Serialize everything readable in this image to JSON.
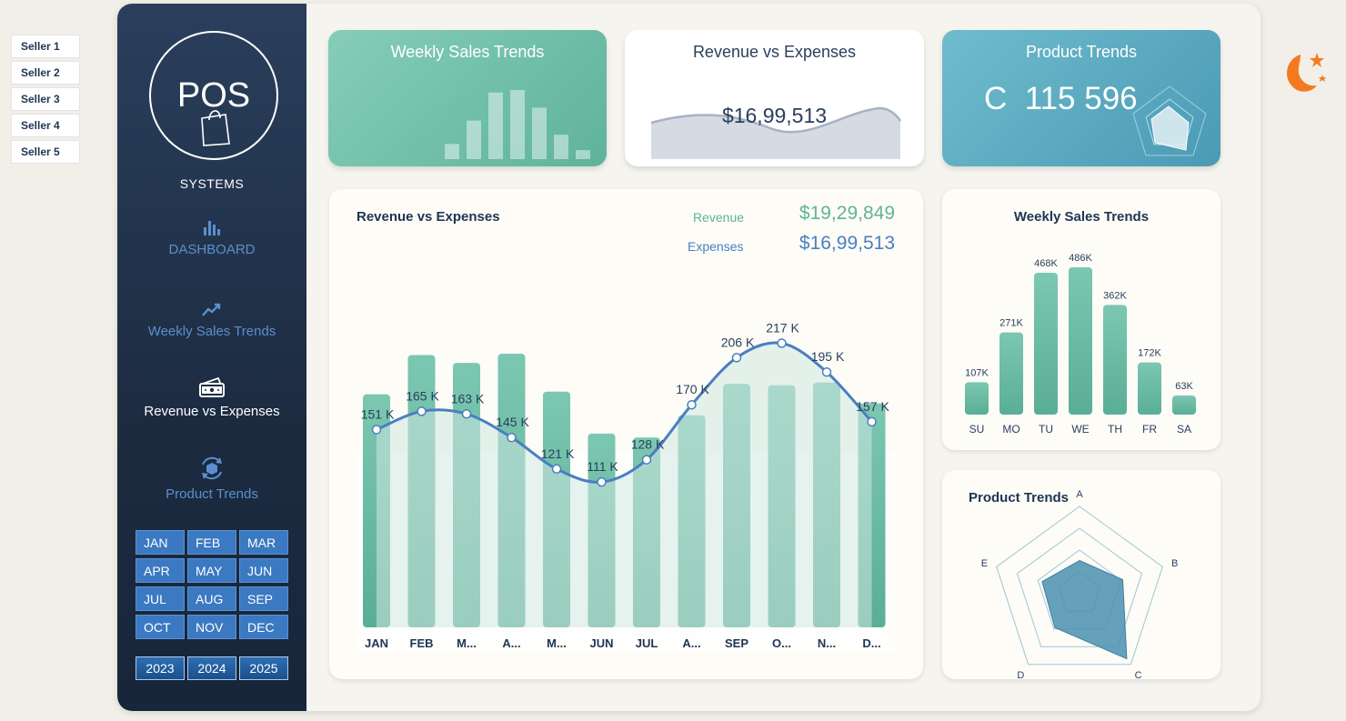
{
  "sellers": [
    "Seller 1",
    "Seller 2",
    "Seller 3",
    "Seller 4",
    "Seller 5"
  ],
  "sidebar": {
    "logo_title": "POS",
    "logo_subtitle": "SYSTEMS",
    "nav": [
      {
        "label": "DASHBOARD",
        "icon": "bar-chart-icon",
        "active": false
      },
      {
        "label": "Weekly Sales Trends",
        "icon": "trend-up-icon",
        "active": false
      },
      {
        "label": "Revenue vs Expenses",
        "icon": "wallet-icon",
        "active": true
      },
      {
        "label": "Product Trends",
        "icon": "cube-cycle-icon",
        "active": false
      }
    ],
    "months": [
      "JAN",
      "FEB",
      "MAR",
      "APR",
      "MAY",
      "JUN",
      "JUL",
      "AUG",
      "SEP",
      "OCT",
      "NOV",
      "DEC"
    ],
    "years": [
      "2023",
      "2024",
      "2025"
    ]
  },
  "kpi": {
    "weekly": {
      "title": "Weekly Sales Trends"
    },
    "revenue": {
      "title": "Revenue vs Expenses",
      "value": "$16,99,513"
    },
    "product": {
      "title": "Product Trends",
      "value": "C  115 596"
    }
  },
  "main_chart": {
    "title": "Revenue vs Expenses",
    "revenue_label": "Revenue",
    "revenue_value": "$19,29,849",
    "expenses_label": "Expenses",
    "expenses_value": "$16,99,513"
  },
  "weekly_card": {
    "title": "Weekly Sales Trends"
  },
  "radar_card": {
    "title": "Product Trends"
  },
  "colors": {
    "teal_bar": "#5fb39b",
    "line_blue": "#4a7fc0",
    "radar_fill": "#4a90b0",
    "sidebar_bg": "#1c2b40",
    "accent_orange": "#f47a1f"
  },
  "chart_data": [
    {
      "type": "bar",
      "title": "Revenue vs Expenses",
      "categories": [
        "JAN",
        "FEB",
        "M...",
        "A...",
        "M...",
        "JUN",
        "JUL",
        "A...",
        "SEP",
        "O...",
        "N...",
        "D..."
      ],
      "series": [
        {
          "name": "Revenue",
          "values": [
            178,
            208,
            202,
            209,
            180,
            148,
            145,
            162,
            186,
            185,
            187,
            171
          ]
        },
        {
          "name": "Expenses",
          "values": [
            151,
            165,
            163,
            145,
            121,
            111,
            128,
            170,
            206,
            217,
            195,
            157
          ],
          "labels": [
            "151 K",
            "165 K",
            "163 K",
            "145 K",
            "121 K",
            "111 K",
            "128 K",
            "170 K",
            "206 K",
            "217 K",
            "195 K",
            "157 K"
          ]
        }
      ]
    },
    {
      "type": "bar",
      "title": "Weekly Sales Trends",
      "categories": [
        "SU",
        "MO",
        "TU",
        "WE",
        "TH",
        "FR",
        "SA"
      ],
      "values": [
        107,
        271,
        468,
        486,
        362,
        172,
        63
      ],
      "labels": [
        "107K",
        "271K",
        "468K",
        "486K",
        "362K",
        "172K",
        "63K"
      ]
    },
    {
      "type": "radar",
      "title": "Product Trends",
      "categories": [
        "A",
        "B",
        "C",
        "D",
        "E"
      ],
      "values": [
        0.38,
        0.52,
        0.92,
        0.48,
        0.45
      ]
    }
  ]
}
